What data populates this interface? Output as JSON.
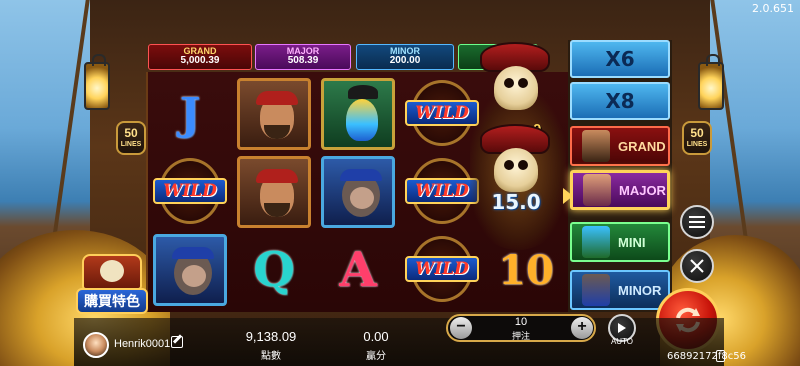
{
  "version": "2.0.651",
  "lines": {
    "count": "50",
    "label": "LINES"
  },
  "jackpots": [
    {
      "name": "GRAND",
      "value": "5,000.39"
    },
    {
      "name": "MAJOR",
      "value": "508.39"
    },
    {
      "name": "MINOR",
      "value": "200.00"
    },
    {
      "name": "MINI",
      "value": ""
    }
  ],
  "reels": {
    "col1": [
      "J",
      "wild",
      "monkey"
    ],
    "col2": [
      "pirate",
      "pirate",
      "Q"
    ],
    "col3": [
      "parrot",
      "monkey",
      "A"
    ],
    "col4": [
      "wild",
      "wild",
      "wild"
    ],
    "col5": [
      "skull",
      "skull",
      "10"
    ],
    "wild_label": "WILD",
    "letters": {
      "j": "J",
      "q": "Q",
      "a": "A",
      "ten": "10"
    }
  },
  "skull_feature": {
    "multiplier": "15.0",
    "partial_multiplier": "0"
  },
  "multiplier_column": {
    "top": "X6",
    "second": "X8",
    "rows": [
      "GRAND",
      "MAJOR",
      "MINI",
      "MINOR"
    ],
    "highlighted": "MAJOR"
  },
  "buy_feature": {
    "label": "購買特色"
  },
  "player": {
    "username": "Henrik0001"
  },
  "balance": {
    "value": "9,138.09",
    "label": "點數"
  },
  "win": {
    "value": "0.00",
    "label": "贏分"
  },
  "bet": {
    "value": "10",
    "label": "押注",
    "minus": "−",
    "plus": "+"
  },
  "auto": {
    "label": "AUTO"
  },
  "session_id": "66892172f8c56",
  "colors": {
    "accent_gold": "#ffd35a",
    "spin_red": "#c8140a",
    "grand": "#7b0d0d",
    "major": "#7a1d89",
    "minor": "#12487c",
    "mini": "#1a6b2d"
  },
  "icons": {
    "menu": "hamburger-icon",
    "close": "crossed-swords-icon",
    "spin": "spin-arrows-icon",
    "auto": "play-icon",
    "edit": "edit-icon"
  }
}
